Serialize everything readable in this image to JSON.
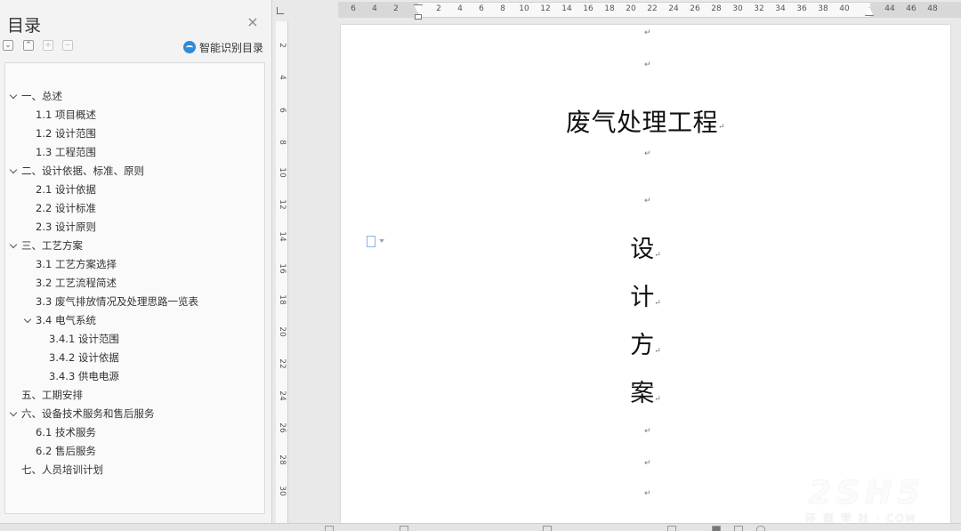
{
  "sidebar": {
    "title": "目录",
    "close_glyph": "×",
    "smart_toc_label": "智能识别目录",
    "toolbar": {
      "collapse_glyph": "⌄",
      "expand_glyph": "⌃",
      "plus_glyph": "+",
      "minus_glyph": "−"
    }
  },
  "toc": [
    {
      "label": "一、总述",
      "expanded": true
    },
    {
      "label": "1.1 项目概述"
    },
    {
      "label": "1.2 设计范围"
    },
    {
      "label": "1.3 工程范围"
    },
    {
      "label": "二、设计依据、标准、原则",
      "expanded": true
    },
    {
      "label": "2.1 设计依据"
    },
    {
      "label": "2.2 设计标准"
    },
    {
      "label": "2.3 设计原则"
    },
    {
      "label": "三、工艺方案",
      "expanded": true
    },
    {
      "label": "3.1 工艺方案选择"
    },
    {
      "label": "3.2 工艺流程简述"
    },
    {
      "label": "3.3 废气排放情况及处理思路一览表"
    },
    {
      "label": "3.4 电气系统",
      "expanded": true
    },
    {
      "label": "3.4.1  设计范围"
    },
    {
      "label": "3.4.2  设计依据"
    },
    {
      "label": "3.4.3  供电电源"
    },
    {
      "label": "五、工期安排"
    },
    {
      "label": "六、设备技术服务和售后服务",
      "expanded": true
    },
    {
      "label": "6.1 技术服务"
    },
    {
      "label": "6.2 售后服务"
    },
    {
      "label": "七、人员培训计划"
    }
  ],
  "ruler": {
    "h_ticks": [
      "6",
      "4",
      "2",
      "2",
      "4",
      "6",
      "8",
      "10",
      "12",
      "14",
      "16",
      "18",
      "20",
      "22",
      "24",
      "26",
      "28",
      "30",
      "32",
      "34",
      "36",
      "38",
      "40",
      "44",
      "46",
      "48"
    ],
    "v_ticks": [
      "2",
      "4",
      "6",
      "8",
      "10",
      "12",
      "14",
      "16",
      "18",
      "20",
      "22",
      "24",
      "26",
      "28",
      "30"
    ]
  },
  "document": {
    "title": "废气处理工程",
    "vertical_chars": [
      "设",
      "计",
      "方",
      "案"
    ],
    "para_mark": "↵"
  },
  "watermark": {
    "logo_text": "2SH5",
    "site_text": "环 保 学 社 · COM"
  }
}
